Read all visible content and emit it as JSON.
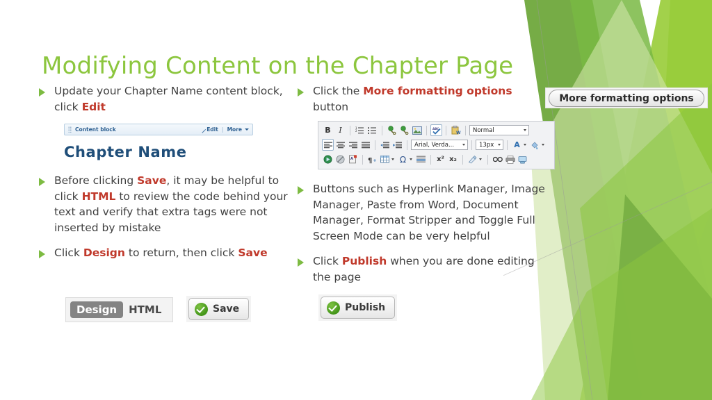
{
  "slide": {
    "title": "Modifying Content on the Chapter Page",
    "title_color": "#8CC63E",
    "accent_red": "#C0392B",
    "bullet_color": "#7DBB42",
    "background": "#FFFFFF"
  },
  "left_column": {
    "bullets": [
      {
        "segments": [
          {
            "text": "Update your Chapter Name content block, click ",
            "emphasis": false
          },
          {
            "text": "Edit",
            "emphasis": true
          }
        ]
      },
      {
        "segments": [
          {
            "text": "Before clicking ",
            "emphasis": false
          },
          {
            "text": "Save",
            "emphasis": true
          },
          {
            "text": ", it may be helpful to click ",
            "emphasis": false
          },
          {
            "text": "HTML",
            "emphasis": true
          },
          {
            "text": " to review the code behind your text and verify that extra tags were not inserted by mistake",
            "emphasis": false
          }
        ]
      },
      {
        "segments": [
          {
            "text": "Click ",
            "emphasis": false
          },
          {
            "text": "Design",
            "emphasis": true
          },
          {
            "text": " to return, then click ",
            "emphasis": false
          },
          {
            "text": "Save",
            "emphasis": true
          }
        ]
      }
    ]
  },
  "right_column": {
    "bullets": [
      {
        "segments": [
          {
            "text": "Click the ",
            "emphasis": false
          },
          {
            "text": "More formatting options",
            "emphasis": true
          },
          {
            "text": " button",
            "emphasis": false
          }
        ]
      },
      {
        "segments": [
          {
            "text": "Buttons such as Hyperlink Manager, Image Manager, Paste from Word, Document Manager, Format Stripper and Toggle Full Screen Mode can be very helpful",
            "emphasis": false
          }
        ]
      },
      {
        "segments": [
          {
            "text": "Click ",
            "emphasis": false
          },
          {
            "text": "Publish",
            "emphasis": true
          },
          {
            "text": " when you are done editing the page",
            "emphasis": false
          }
        ]
      }
    ]
  },
  "content_block_widget": {
    "title": "Content block",
    "edit_label": "Edit",
    "separator": "|",
    "more_label": "More",
    "heading": "Chapter Name",
    "heading_color": "#1F4E79"
  },
  "tooltip_callout": {
    "label": "More formatting options"
  },
  "editor_toolbar": {
    "row1": {
      "bold": "B",
      "italic": "I",
      "ordered_list_icon": "ordered-list-icon",
      "unordered_list_icon": "unordered-list-icon",
      "hyperlink_manager_icon": "hyperlink-manager-icon",
      "remove_link_icon": "remove-link-icon",
      "image_manager_icon": "image-manager-icon",
      "spellcheck_icon": "spellcheck-icon",
      "paste_from_word_icon": "paste-from-word-icon",
      "paragraph_style": "Normal"
    },
    "row2": {
      "align_left_icon": "align-left-icon",
      "align_center_icon": "align-center-icon",
      "align_right_icon": "align-right-icon",
      "align_justify_icon": "align-justify-icon",
      "outdent_icon": "outdent-icon",
      "indent_icon": "indent-icon",
      "font_name": "Arial, Verda...",
      "font_size": "13px",
      "fore_color": "A",
      "back_color_icon": "background-color-icon"
    },
    "row3": {
      "flash_manager_icon": "flash-manager-icon",
      "media_manager_icon": "media-manager-icon",
      "document_manager_icon": "document-manager-icon",
      "paragraph_mark_icon": "paragraph-mark-icon",
      "table_icon": "insert-table-icon",
      "symbol_icon": "symbol-omega-icon",
      "horizontal_rule_icon": "horizontal-rule-icon",
      "superscript": "x²",
      "subscript": "x₂",
      "format_stripper_icon": "format-stripper-icon",
      "find_replace_icon": "find-and-replace-icon",
      "print_icon": "print-icon",
      "toggle_full_screen_icon": "toggle-full-screen-icon"
    }
  },
  "mode_buttons": {
    "design": "Design",
    "html": "HTML"
  },
  "save_button": {
    "label": "Save",
    "icon": "green-check-icon"
  },
  "publish_button": {
    "label": "Publish",
    "icon": "green-check-icon"
  }
}
